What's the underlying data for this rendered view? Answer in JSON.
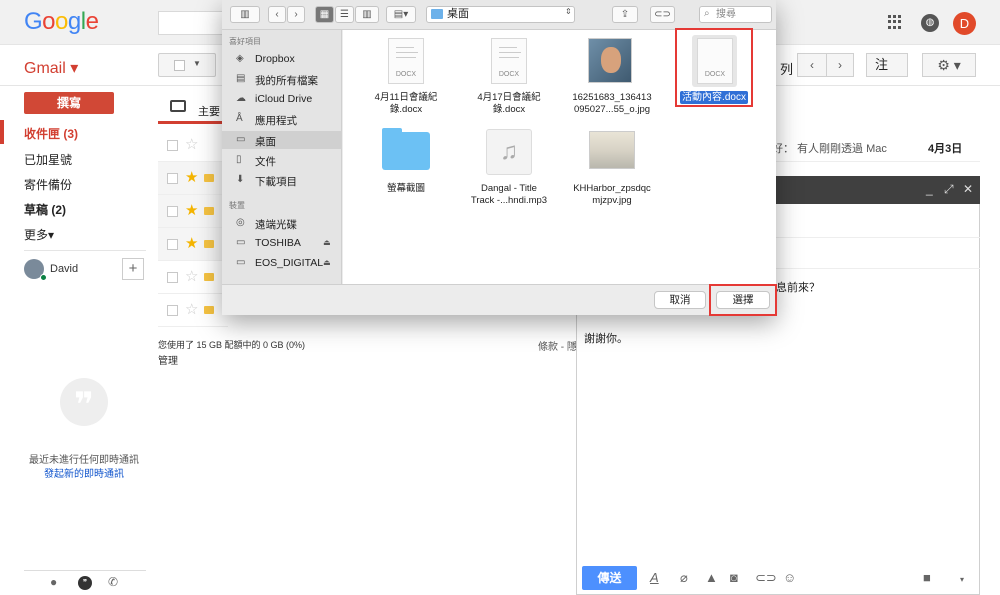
{
  "header": {
    "logo_letters": [
      "G",
      "o",
      "o",
      "g",
      "l",
      "e"
    ],
    "logo_colors": [
      "#4285f4",
      "#ea4335",
      "#fbbc05",
      "#4285f4",
      "#34a853",
      "#ea4335"
    ],
    "avatar_letter": "D"
  },
  "toolbar": {
    "app_label": "Gmail ▾",
    "page_suffix": "列",
    "prev": "‹",
    "next": "›",
    "lang": "注",
    "gear": "⚙ ▾"
  },
  "nav": {
    "compose": "撰寫",
    "inbox": "收件匣 (3)",
    "starred": "已加星號",
    "sent": "寄件備份",
    "drafts": "草稿 (2)",
    "more": "更多▾"
  },
  "hangouts": {
    "user": "David",
    "no_chats": "最近未進行任何即時通訊",
    "start_chat": "發起新的即時通訊"
  },
  "mail": {
    "tab_primary": "主要",
    "email1_snippet": "好： 有人剛剛透過 Mac",
    "email1_date": "4月3日",
    "storage": "您使用了 15 GB 配額中的 0 GB (0%)",
    "manage": "管理",
    "terms": "條款 - 隱"
  },
  "compose_window": {
    "body_line1": "息前來？",
    "body_line2": "謝謝你。",
    "send": "傳送",
    "accent": "#4d90fe"
  },
  "dialog": {
    "location": "桌面",
    "search_placeholder": "搜尋",
    "favorites_header": "喜好項目",
    "favorites": [
      "Dropbox",
      "我的所有檔案",
      "iCloud Drive",
      "應用程式",
      "桌面",
      "文件",
      "下載項目"
    ],
    "devices_header": "裝置",
    "devices": [
      "遠端光碟",
      "TOSHIBA",
      "EOS_DIGITAL"
    ],
    "files": [
      {
        "name": "4月11日會議紀\n錄.docx",
        "type": "docx"
      },
      {
        "name": "4月17日會議紀\n錄.docx",
        "type": "docx"
      },
      {
        "name": "16251683_136413\n095027...55_o.jpg",
        "type": "jpg"
      },
      {
        "name": "活動內容.docx",
        "type": "docx",
        "selected": true
      },
      {
        "name": "螢幕截圖",
        "type": "folder"
      },
      {
        "name": "Dangal - Title\nTrack -...hndi.mp3",
        "type": "mp3"
      },
      {
        "name": "KHHarbor_zpsdqc\nmjzpv.jpg",
        "type": "jpg"
      }
    ],
    "docx_badge": "DOCX",
    "cancel": "取消",
    "choose": "選擇"
  }
}
